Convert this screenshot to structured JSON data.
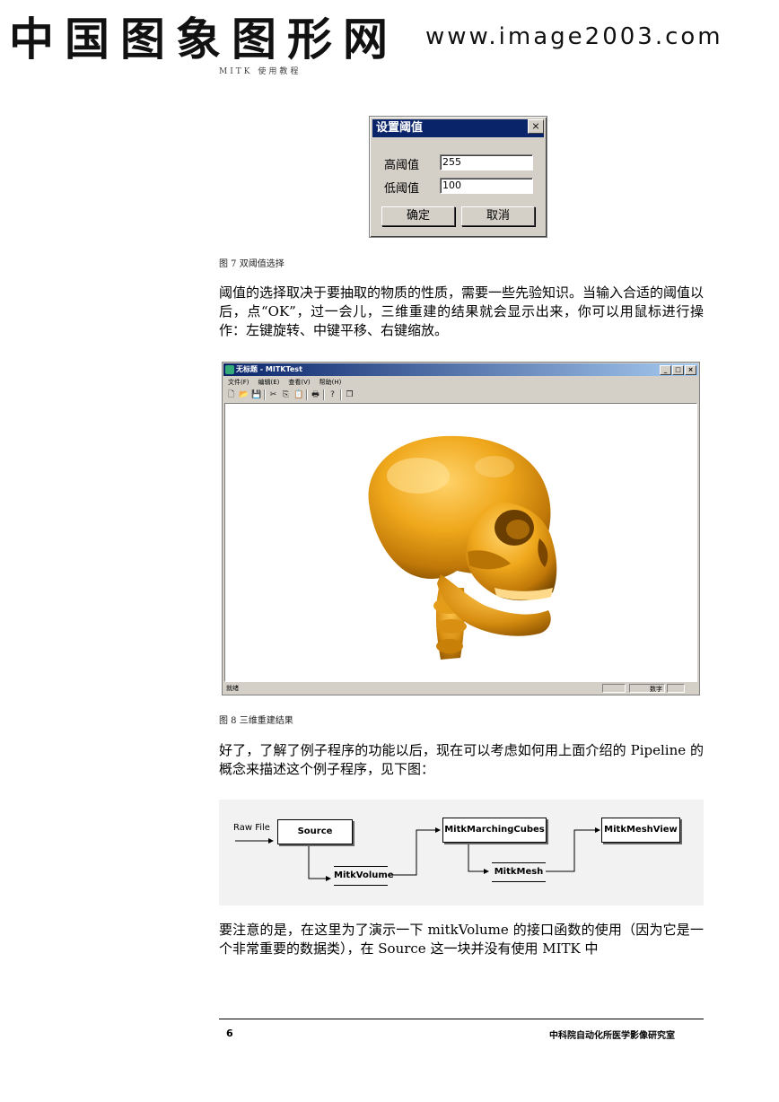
{
  "watermark": {
    "site_name": "中国图象图形网",
    "url": "www.image2003.com"
  },
  "running_head": "MITK 使用教程",
  "dialog": {
    "title": "设置阈值",
    "close_label": "×",
    "high_label": "高阈值",
    "high_value": "255",
    "low_label": "低阈值",
    "low_value": "100",
    "ok_label": "确定",
    "cancel_label": "取消"
  },
  "figure7_caption": "图 7 双阈值选择",
  "paragraph1": "阈值的选择取决于要抽取的物质的性质，需要一些先验知识。当输入合适的阈值以后，点“OK”，过一会儿，三维重建的结果就会显示出来，你可以用鼠标进行操作：左键旋转、中键平移、右键缩放。",
  "app_window": {
    "title": "无标题 - MITKTest",
    "window_buttons": [
      "_",
      "□",
      "×"
    ],
    "menu": [
      "文件(F)",
      "编辑(E)",
      "查看(V)",
      "帮助(H)"
    ],
    "toolbar_icons": [
      "new-icon",
      "open-icon",
      "save-icon",
      "cut-icon",
      "copy-icon",
      "paste-icon",
      "print-icon",
      "help-icon",
      "window-icon"
    ],
    "toolbar_glyphs": [
      "🗋",
      "📂",
      "💾",
      "✂",
      "⎘",
      "📋",
      "🖶",
      "?",
      "❐"
    ],
    "status_left": "就绪",
    "status_num": "数字"
  },
  "figure8_caption": "图 8 三维重建结果",
  "paragraph2": "好了，了解了例子程序的功能以后，现在可以考虑如何用上面介绍的 Pipeline 的概念来描述这个例子程序，见下图：",
  "pipeline": {
    "input_label": "Raw File",
    "source": "Source",
    "volume": "MitkVolume",
    "marching": "MitkMarchingCubes",
    "mesh": "MitkMesh",
    "view": "MitkMeshView"
  },
  "paragraph3": "要注意的是，在这里为了演示一下 mitkVolume 的接口函数的使用（因为它是一个非常重要的数据类），在 Source 这一块并没有使用 MITK 中",
  "footer": {
    "page_number": "6",
    "organization": "中科院自动化所医学影像研究室"
  }
}
